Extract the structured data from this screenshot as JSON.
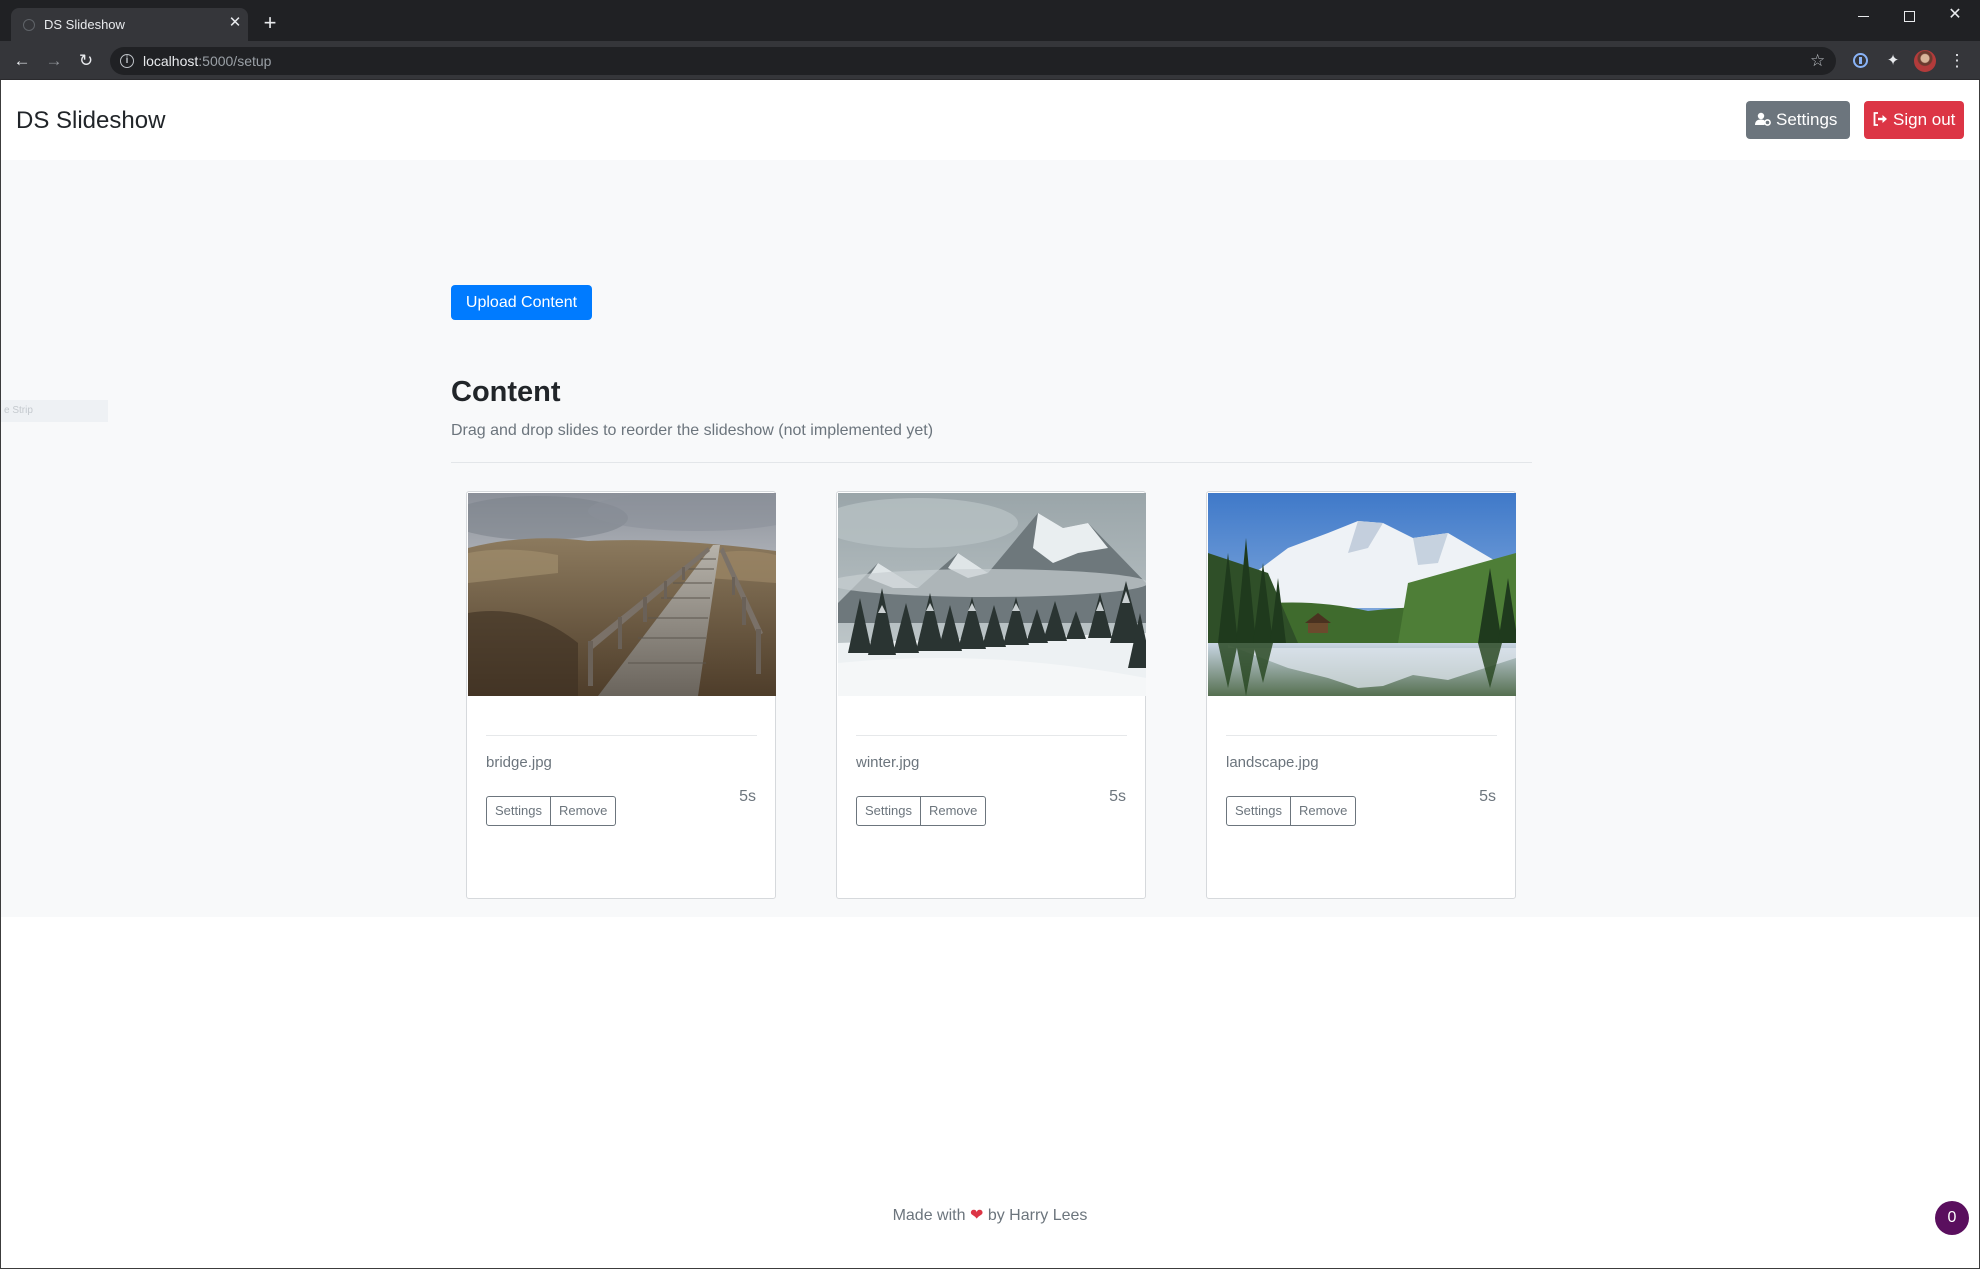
{
  "browser": {
    "tab_title": "DS Slideshow",
    "url_host": "localhost",
    "url_path": ":5000/setup"
  },
  "navbar": {
    "brand": "DS Slideshow",
    "settings_label": "Settings",
    "signout_label": "Sign out"
  },
  "main": {
    "upload_label": "Upload Content",
    "heading": "Content",
    "subtitle": "Drag and drop slides to reorder the slideshow (not implemented yet)",
    "sidebar_ghost": "e Strip"
  },
  "slides": [
    {
      "name": "bridge.jpg",
      "duration": "5s",
      "settings_label": "Settings",
      "remove_label": "Remove",
      "image": "bridge-photo"
    },
    {
      "name": "winter.jpg",
      "duration": "5s",
      "settings_label": "Settings",
      "remove_label": "Remove",
      "image": "winter-mountain-photo"
    },
    {
      "name": "landscape.jpg",
      "duration": "5s",
      "settings_label": "Settings",
      "remove_label": "Remove",
      "image": "landscape-lake-photo"
    }
  ],
  "footer": {
    "made_with": "Made with",
    "heart": "❤",
    "by": "by Harry Lees"
  },
  "corner_badge": "0",
  "colors": {
    "primary": "#007bff",
    "secondary": "#6c757d",
    "danger": "#dc3545",
    "page_bg": "#f8f9fa"
  }
}
